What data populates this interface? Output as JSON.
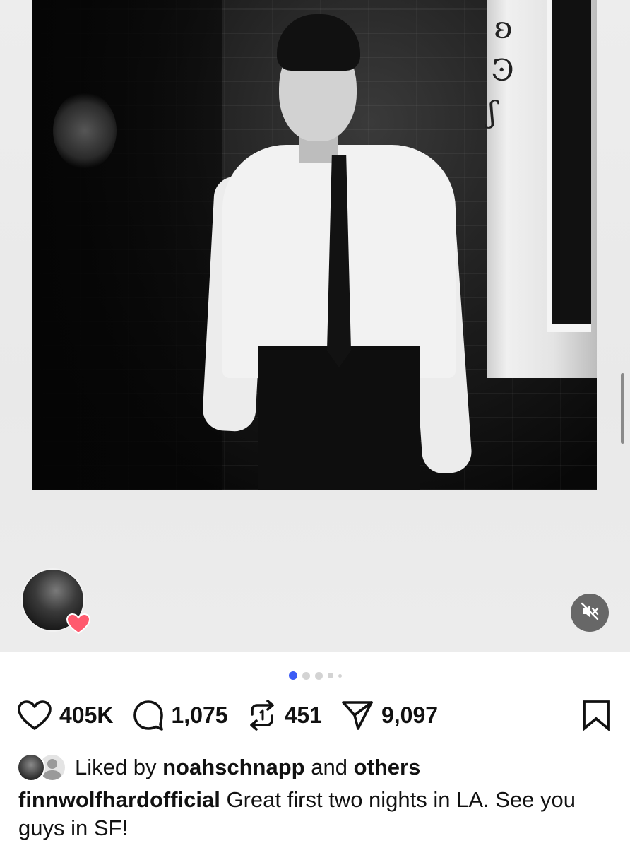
{
  "post": {
    "media_count": 5,
    "active_index": 0,
    "muted": true
  },
  "actions": {
    "likes": "405K",
    "comments": "1,075",
    "reposts": "451",
    "shares": "9,097"
  },
  "liked_by": {
    "prefix": "Liked by",
    "user": "noahschnapp",
    "connector": "and",
    "others": "others"
  },
  "caption": {
    "username": "finnwolfhardofficial",
    "text": "Great first two nights in LA. See you guys in SF!"
  },
  "colors": {
    "accent_dot": "#3b5bf5",
    "heart_badge": "#ff5a6e"
  },
  "icons": [
    "heart-icon",
    "comment-icon",
    "repost-icon",
    "share-icon",
    "bookmark-icon",
    "mute-icon"
  ]
}
